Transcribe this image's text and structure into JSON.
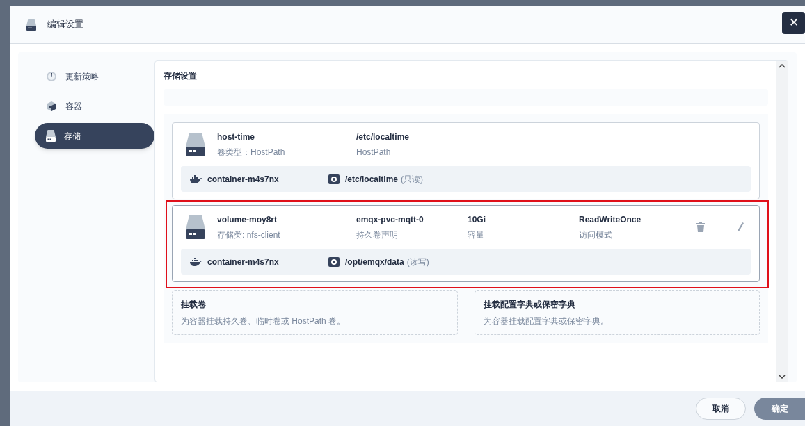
{
  "dialog": {
    "title": "编辑设置",
    "close_label": "✕"
  },
  "sidebar": {
    "items": [
      {
        "label": "更新策略",
        "kind": "gauge",
        "selected": false
      },
      {
        "label": "容器",
        "kind": "cube",
        "selected": false
      },
      {
        "label": "存储",
        "kind": "disk",
        "selected": true
      }
    ]
  },
  "section": {
    "title": "存储设置"
  },
  "volumes": [
    {
      "name": "host-time",
      "subtitle": "卷类型：HostPath",
      "highlighted": false,
      "fields": [
        {
          "value": "/etc/localtime",
          "label": "HostPath"
        }
      ],
      "actions": false,
      "mounts": [
        {
          "container": "container-m4s7nx",
          "path": "/etc/localtime",
          "mode": "(只读)"
        }
      ]
    },
    {
      "name": "volume-moy8rt",
      "subtitle": "存储类: nfs-client",
      "highlighted": true,
      "fields": [
        {
          "value": "emqx-pvc-mqtt-0",
          "label": "持久卷声明"
        },
        {
          "value": "10Gi",
          "label": "容量"
        },
        {
          "value": "ReadWriteOnce",
          "label": "访问模式"
        }
      ],
      "actions": true,
      "mounts": [
        {
          "container": "container-m4s7nx",
          "path": "/opt/emqx/data",
          "mode": "(读写)"
        }
      ]
    }
  ],
  "add_options": [
    {
      "title": "挂载卷",
      "description": "为容器挂载持久卷、临时卷或 HostPath 卷。"
    },
    {
      "title": "挂载配置字典或保密字典",
      "description": "为容器挂载配置字典或保密字典。"
    }
  ],
  "footer": {
    "cancel": "取消",
    "confirm": "确定"
  }
}
